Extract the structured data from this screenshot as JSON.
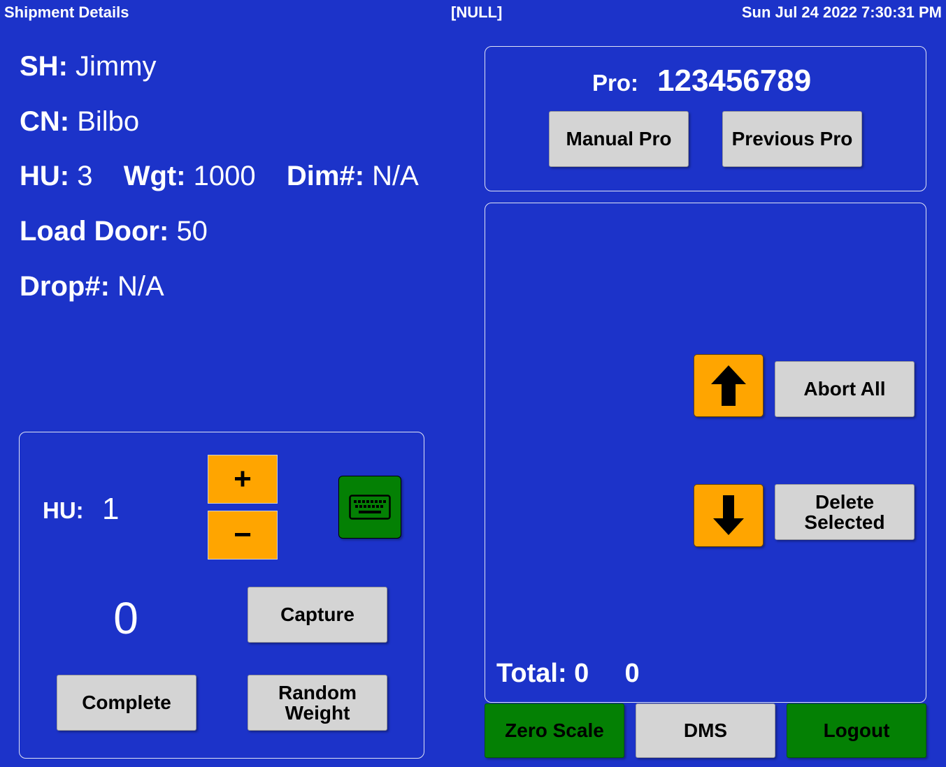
{
  "header": {
    "title": "Shipment Details",
    "center": "[NULL]",
    "datetime": "Sun Jul 24 2022 7:30:31 PM"
  },
  "shipment": {
    "sh_label": "SH:",
    "sh_value": "Jimmy",
    "cn_label": "CN:",
    "cn_value": "Bilbo",
    "hu_label": "HU:",
    "hu_value": "3",
    "wgt_label": "Wgt:",
    "wgt_value": "1000",
    "dim_label": "Dim#:",
    "dim_value": "N/A",
    "load_door_label": "Load Door:",
    "load_door_value": "50",
    "drop_label": "Drop#:",
    "drop_value": "N/A"
  },
  "capture_panel": {
    "hu_label": "HU:",
    "hu_count": "1",
    "plus_label": "+",
    "minus_label": "−",
    "weight_reading": "0",
    "capture_label": "Capture",
    "complete_label": "Complete",
    "random_weight_label": "Random Weight",
    "keyboard_icon": "keyboard-icon"
  },
  "pro_panel": {
    "pro_label": "Pro:",
    "pro_value": "123456789",
    "manual_pro_label": "Manual Pro",
    "previous_pro_label": "Previous Pro"
  },
  "list_panel": {
    "abort_all_label": "Abort All",
    "delete_selected_label": "Delete Selected",
    "total_label": "Total:",
    "total_count": "0",
    "total_weight": "0",
    "up_icon": "arrow-up-icon",
    "down_icon": "arrow-down-icon"
  },
  "footer": {
    "zero_scale_label": "Zero Scale",
    "dms_label": "DMS",
    "logout_label": "Logout"
  },
  "colors": {
    "background": "#1c33c9",
    "button_gray": "#d4d4d4",
    "button_green": "#048004",
    "button_orange": "#ffa500"
  }
}
